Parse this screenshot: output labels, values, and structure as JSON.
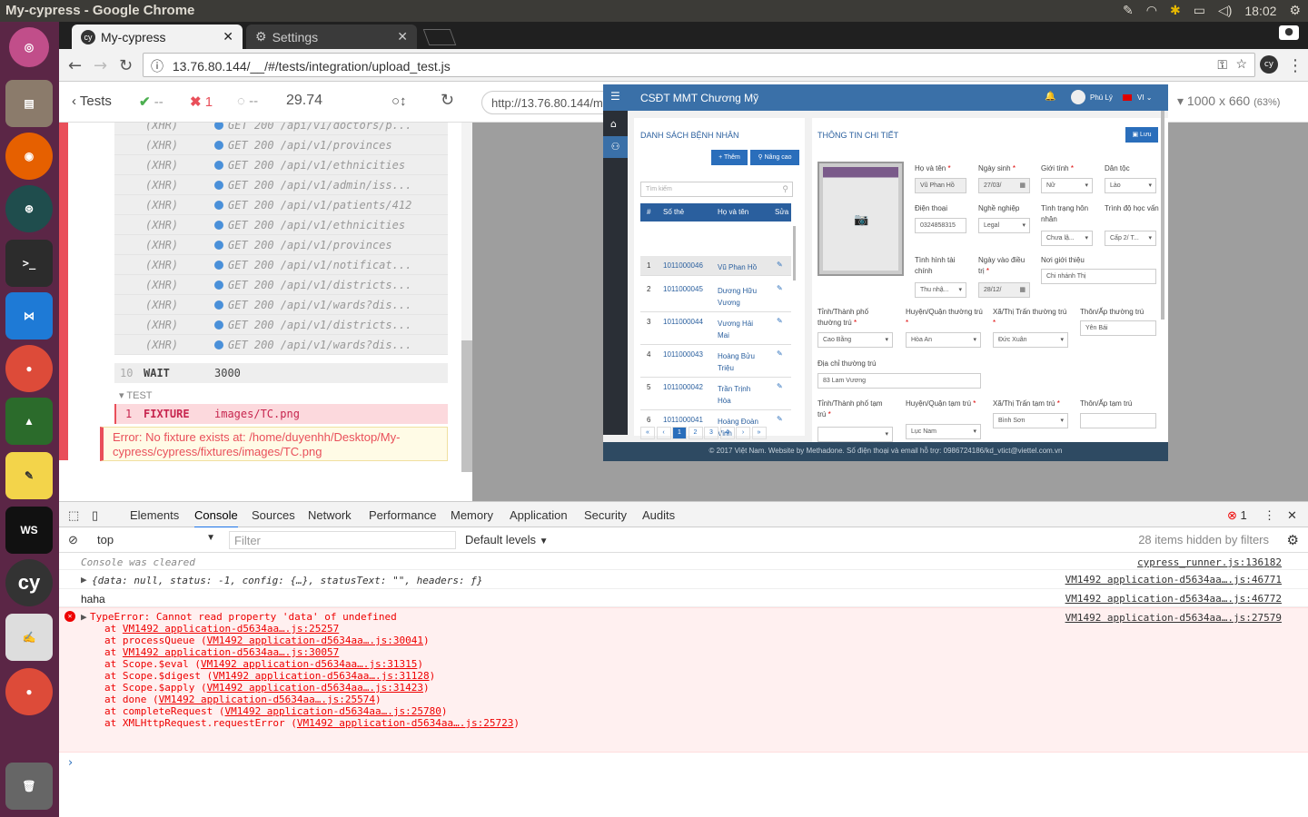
{
  "os": {
    "window_title": "My-cypress - Google Chrome",
    "clock": "18:02",
    "launcher": [
      "ubuntu-icon",
      "files-icon",
      "firefox-icon",
      "gitkraken-icon",
      "terminal-icon",
      "vscode-icon",
      "chrome-icon",
      "rocket-icon",
      "notes-icon",
      "webstorm-icon",
      "cypress-icon",
      "text-editor-icon",
      "chrome-icon",
      "trash-icon"
    ]
  },
  "browser": {
    "tabs": [
      {
        "label": "My-cypress"
      },
      {
        "label": "Settings"
      }
    ],
    "url": "13.76.80.144/__/#/tests/integration/upload_test.js"
  },
  "runner": {
    "tests_label": "Tests",
    "passed": "--",
    "failed": "1",
    "pending": "--",
    "duration": "29.74",
    "aut_url": "http://13.76.80.144/main/patients/412/edit",
    "viewport": "1000 x 660",
    "scale": "(63%)"
  },
  "commands": [
    {
      "type": "(XHR)",
      "msg": "GET 200 /api/v1/doctors/p..."
    },
    {
      "type": "(XHR)",
      "msg": "GET 200 /api/v1/provinces"
    },
    {
      "type": "(XHR)",
      "msg": "GET 200 /api/v1/ethnicities"
    },
    {
      "type": "(XHR)",
      "msg": "GET 200 /api/v1/admin/iss..."
    },
    {
      "type": "(XHR)",
      "msg": "GET 200 /api/v1/patients/412"
    },
    {
      "type": "(XHR)",
      "msg": "GET 200 /api/v1/ethnicities"
    },
    {
      "type": "(XHR)",
      "msg": "GET 200 /api/v1/provinces"
    },
    {
      "type": "(XHR)",
      "msg": "GET 200 /api/v1/notificat..."
    },
    {
      "type": "(XHR)",
      "msg": "GET 200 /api/v1/districts..."
    },
    {
      "type": "(XHR)",
      "msg": "GET 200 /api/v1/wards?dis..."
    },
    {
      "type": "(XHR)",
      "msg": "GET 200 /api/v1/districts..."
    },
    {
      "type": "(XHR)",
      "msg": "GET 200 /api/v1/wards?dis..."
    }
  ],
  "wait": {
    "num": "10",
    "name": "WAIT",
    "value": "3000"
  },
  "test_section": "TEST",
  "fixture": {
    "num": "1",
    "name": "FIXTURE",
    "value": "images/TC.png"
  },
  "error_text": "Error: No fixture exists at: /home/duyenhh/Desktop/My-cypress/cypress/fixtures/images/TC.png",
  "app": {
    "brand": "CSĐT MMT Chương Mỹ",
    "user": "Phú Lý",
    "lang": "VI",
    "list_title": "DANH SÁCH BỆNH NHÂN",
    "add_btn": "+ Thêm",
    "adv_btn": "Nâng cao",
    "search_ph": "Tìm kiếm",
    "cols": [
      "#",
      "Số thẻ",
      "Họ và tên",
      "Sửa"
    ],
    "rows": [
      {
        "n": "1",
        "id": "1011000046",
        "name": "Vũ Phan Hồ"
      },
      {
        "n": "2",
        "id": "1011000045",
        "name": "Dương Hữu Vương"
      },
      {
        "n": "3",
        "id": "1011000044",
        "name": "Vương Hải Mai"
      },
      {
        "n": "4",
        "id": "1011000043",
        "name": "Hoàng Bửu Triệu"
      },
      {
        "n": "5",
        "id": "1011000042",
        "name": "Trần Trịnh Hòa"
      },
      {
        "n": "6",
        "id": "1011000041",
        "name": "Hoàng Đoàn Vinh"
      }
    ],
    "pages": [
      "«",
      "‹",
      "1",
      "2",
      "3",
      "4",
      "›",
      "»"
    ],
    "detail_title": "THÔNG TIN CHI TIẾT",
    "save_btn": "Lưu",
    "f_name": "Họ và tên",
    "v_name": "Vũ Phan Hồ",
    "f_dob": "Ngày sinh",
    "v_dob": "27/03/",
    "f_gender": "Giới tính",
    "v_gender": "Nữ",
    "f_ethnic": "Dân tộc",
    "v_ethnic": "Lào",
    "f_phone": "Điện thoại",
    "v_phone": "0324858315",
    "f_job": "Nghề nghiệp",
    "v_job": "Legal",
    "f_marital": "Tình trạng hôn nhân",
    "v_marital": "Chưa lậ...",
    "f_edu": "Trình độ học vấn",
    "v_edu": "Cấp 2/ T...",
    "f_finance": "Tình hình tài chính",
    "v_finance": "Thu nhậ...",
    "f_start": "Ngày vào điều trị",
    "v_start": "28/12/",
    "f_ref": "Nơi giới thiệu",
    "v_ref": "Chi nhánh Thị",
    "f_prov": "Tỉnh/Thành phố thường trú",
    "v_prov": "Cao Bằng",
    "f_dist": "Huyện/Quận thường trú",
    "v_dist": "Hòa An",
    "f_ward": "Xã/Thị Trấn thường trú",
    "v_ward": "Đức Xuân",
    "f_hamlet": "Thôn/Ấp thường trú",
    "v_hamlet": "Yên Bái",
    "f_addr": "Địa chỉ thường trú",
    "v_addr": "83 Lam Vương",
    "f_tprov": "Tỉnh/Thành phố tạm trú",
    "f_tdist": "Huyện/Quận tạm trú",
    "v_tdist": "Lục Nam",
    "f_tward": "Xã/Thị Trấn tạm trú",
    "v_tward": "Bình Sơn",
    "f_thamlet": "Thôn/Ấp tạm trú",
    "footer": "© 2017 Việt Nam. Website by Methadone. Số điện thoại và email hỗ trợ: 0986724186/kd_vtict@viettel.com.vn"
  },
  "devtools": {
    "tabs": [
      "Elements",
      "Console",
      "Sources",
      "Network",
      "Performance",
      "Memory",
      "Application",
      "Security",
      "Audits"
    ],
    "error_count": "1",
    "context": "top",
    "filter_ph": "Filter",
    "levels": "Default levels",
    "hidden": "28 items hidden by filters",
    "rows": [
      {
        "text": "Console was cleared",
        "src": "cypress_runner.js:136182"
      },
      {
        "text": "{data: null, status: -1, config: {…}, statusText: \"\", headers: ƒ}",
        "src": "VM1492 application-d5634aa….js:46771"
      },
      {
        "text": "haha",
        "src": "VM1492 application-d5634aa….js:46772"
      }
    ],
    "error": {
      "text": "TypeError: Cannot read property 'data' of undefined",
      "src": "VM1492 application-d5634aa….js:27579",
      "stack": [
        {
          "at": "at ",
          "fn": "",
          "loc": "VM1492 application-d5634aa….js:25257"
        },
        {
          "at": "at processQueue (",
          "fn": "",
          "loc": "VM1492 application-d5634aa….js:30041"
        },
        {
          "at": "at ",
          "fn": "",
          "loc": "VM1492 application-d5634aa….js:30057"
        },
        {
          "at": "at Scope.$eval (",
          "fn": "",
          "loc": "VM1492 application-d5634aa….js:31315"
        },
        {
          "at": "at Scope.$digest (",
          "fn": "",
          "loc": "VM1492 application-d5634aa….js:31128"
        },
        {
          "at": "at Scope.$apply (",
          "fn": "",
          "loc": "VM1492 application-d5634aa….js:31423"
        },
        {
          "at": "at done (",
          "fn": "",
          "loc": "VM1492 application-d5634aa….js:25574"
        },
        {
          "at": "at completeRequest (",
          "fn": "",
          "loc": "VM1492 application-d5634aa….js:25780"
        },
        {
          "at": "at XMLHttpRequest.requestError (",
          "fn": "",
          "loc": "VM1492 application-d5634aa….js:25723"
        }
      ]
    }
  },
  "colors": {
    "failed": "#e94f5a",
    "passed": "#4caf50",
    "app_blue": "#3a70a8"
  }
}
